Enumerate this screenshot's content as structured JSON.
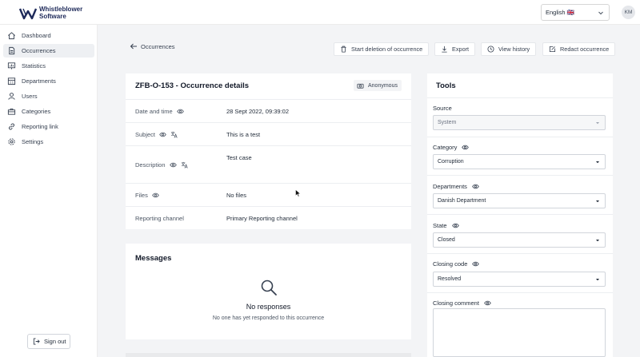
{
  "brand": {
    "line1": "Whistleblower",
    "line2": "Software"
  },
  "topbar": {
    "language": "English 🇬🇧",
    "avatar_initials": "KM"
  },
  "sidebar": {
    "items": [
      {
        "label": "Dashboard",
        "icon": "home-icon"
      },
      {
        "label": "Occurrences",
        "icon": "document-icon",
        "active": true
      },
      {
        "label": "Statistics",
        "icon": "chart-icon"
      },
      {
        "label": "Departments",
        "icon": "building-icon"
      },
      {
        "label": "Users",
        "icon": "users-icon"
      },
      {
        "label": "Categories",
        "icon": "briefcase-icon"
      },
      {
        "label": "Reporting link",
        "icon": "link-icon"
      },
      {
        "label": "Settings",
        "icon": "gear-icon"
      }
    ],
    "sign_out": "Sign out"
  },
  "header": {
    "back_label": "Occurrences",
    "actions": {
      "delete": "Start deletion of occurrence",
      "export": "Export",
      "history": "View history",
      "redact": "Redact occurrence"
    }
  },
  "details": {
    "title": "ZFB-O-153 - Occurrence details",
    "badge": "Anonymous",
    "rows": [
      {
        "label": "Date and time",
        "value": "28 Sept 2022, 09:39:02"
      },
      {
        "label": "Subject",
        "value": "This is a test"
      },
      {
        "label": "Description",
        "value": "Test case"
      },
      {
        "label": "Files",
        "value": "No files"
      },
      {
        "label": "Reporting channel",
        "value": "Primary Reporting channel"
      }
    ]
  },
  "messages": {
    "title": "Messages",
    "empty_title": "No responses",
    "empty_sub": "No one has yet responded to this occurrence"
  },
  "tools": {
    "title": "Tools",
    "source": {
      "label": "Source",
      "value": "System"
    },
    "category": {
      "label": "Category",
      "value": "Corruption"
    },
    "departments": {
      "label": "Departments",
      "value": "Danish Department"
    },
    "state": {
      "label": "State",
      "value": "Closed"
    },
    "closing_code": {
      "label": "Closing code",
      "value": "Resolved"
    },
    "closing_comment": {
      "label": "Closing comment"
    }
  },
  "colors": {
    "brand": "#1e2a5a",
    "active_nav": "#eef0f3",
    "background": "#f3f4f6"
  }
}
